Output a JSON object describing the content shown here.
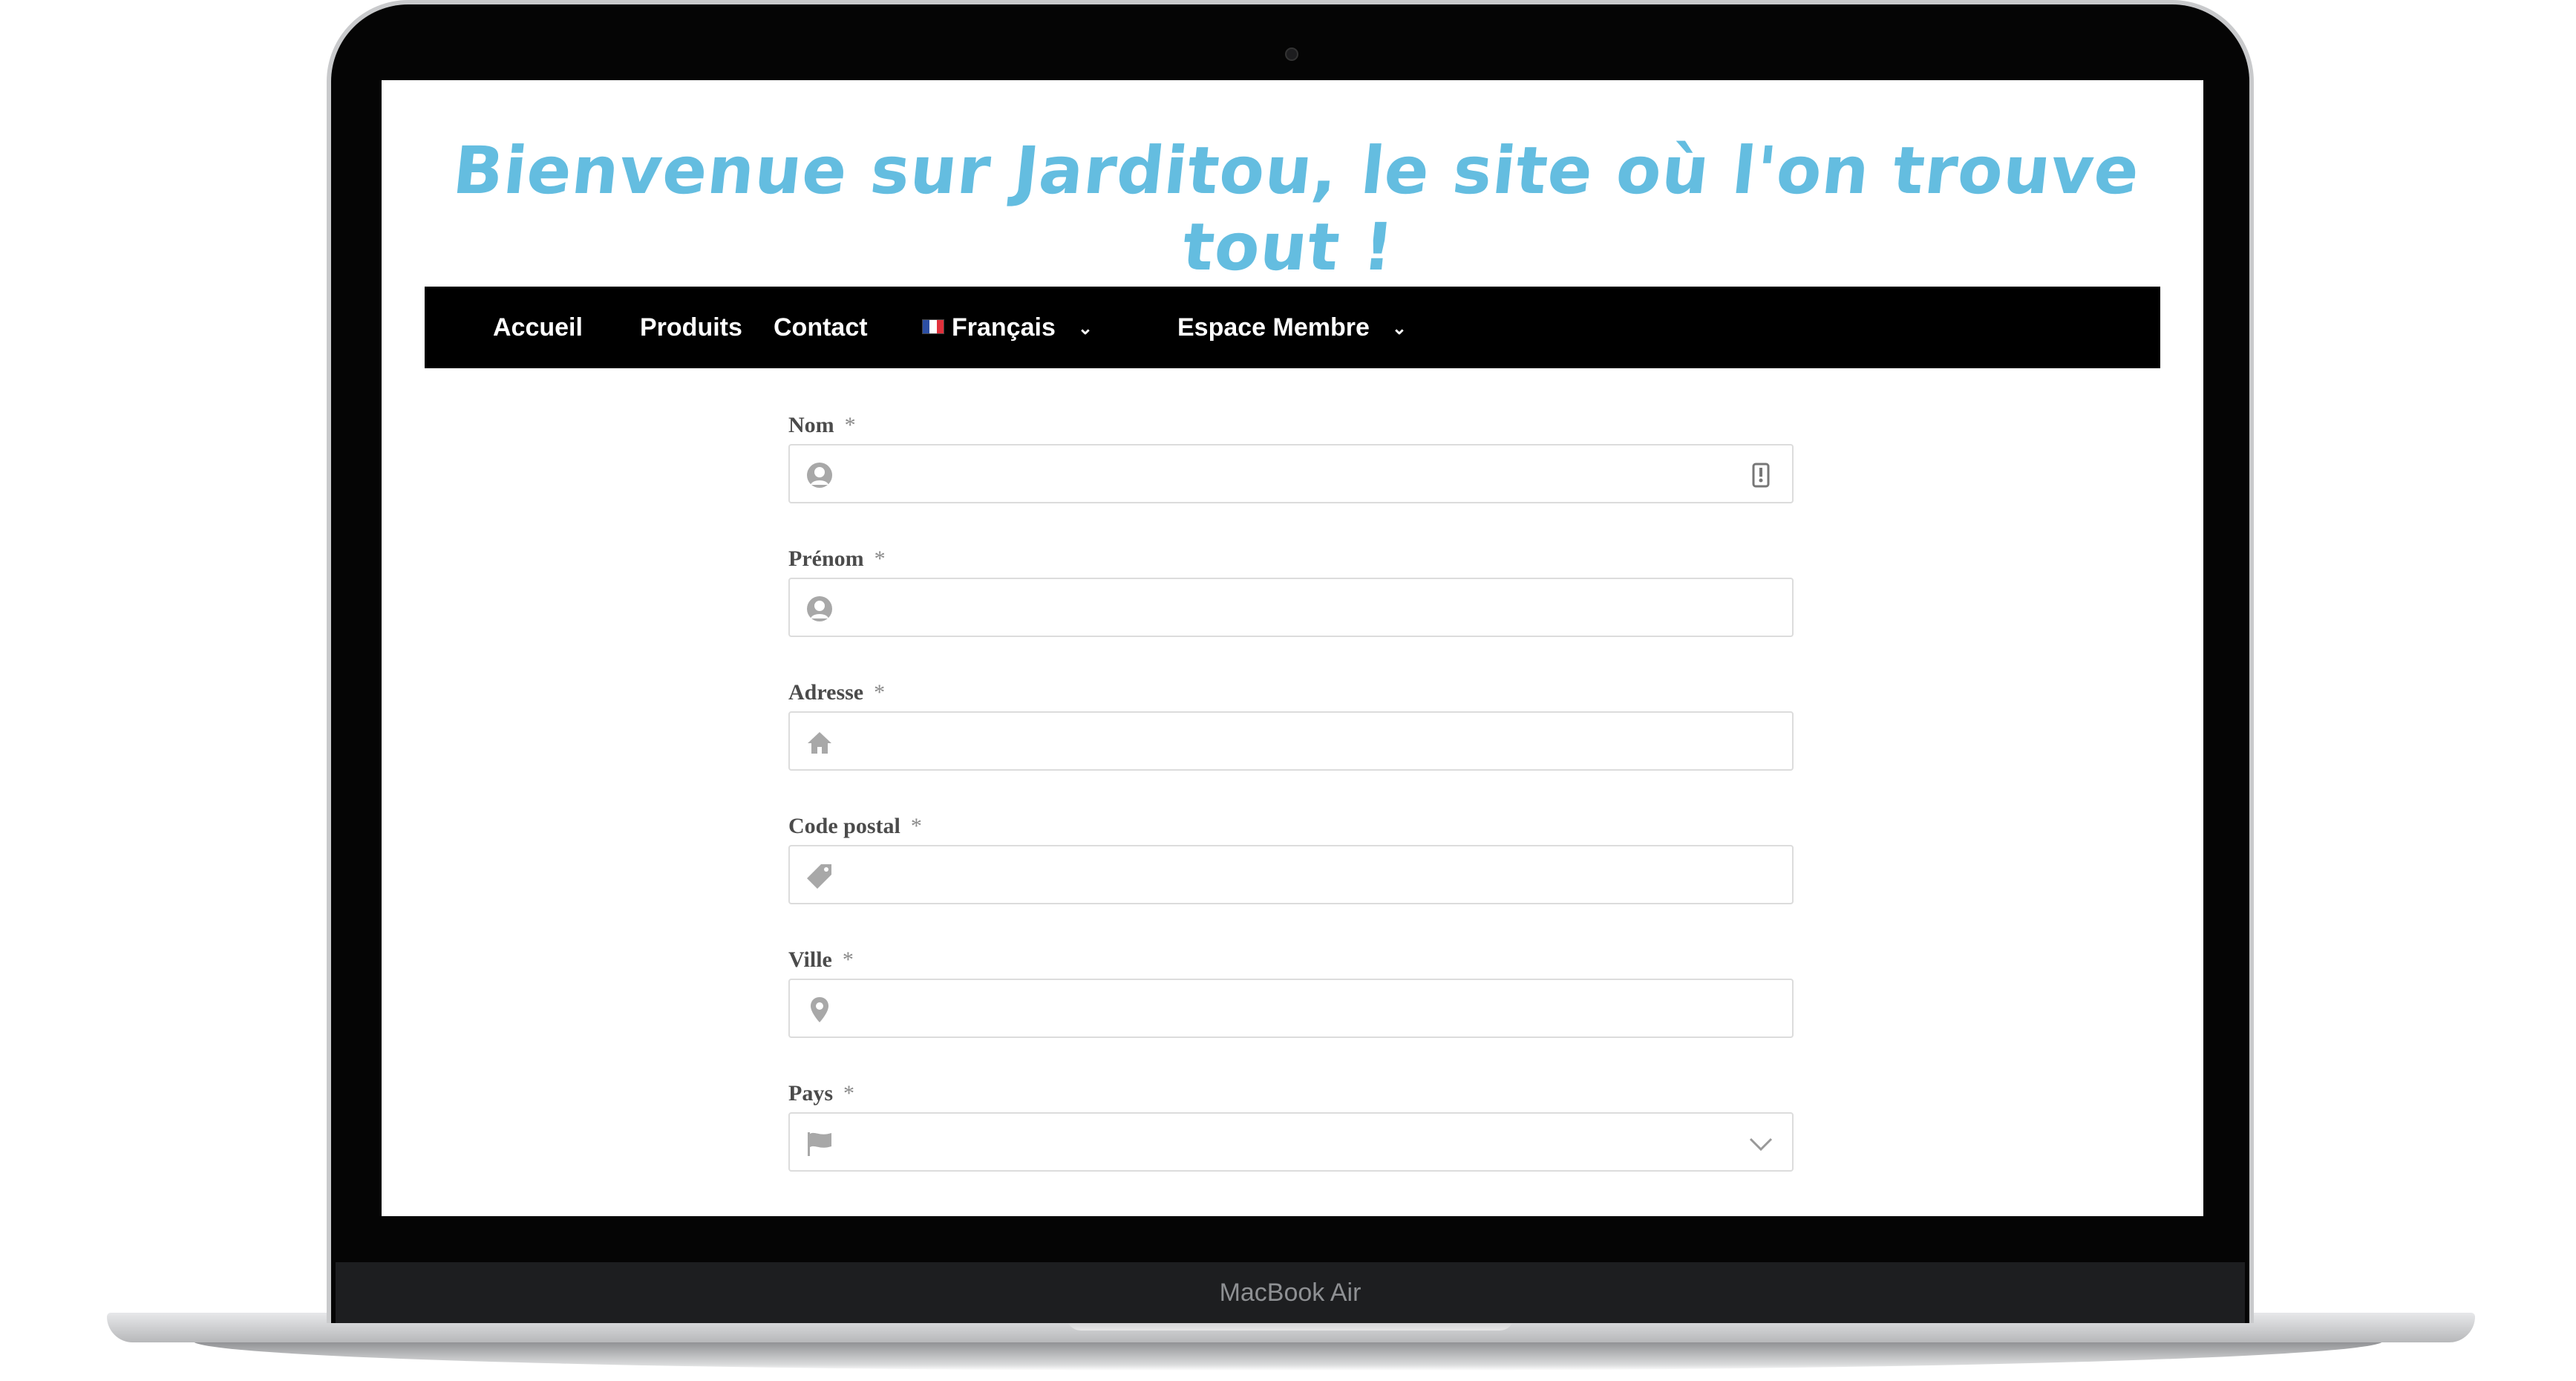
{
  "device": {
    "model_label": "MacBook Air"
  },
  "site": {
    "title": "Bienvenue sur Jarditou, le site où l'on trouve tout !"
  },
  "nav": {
    "items": [
      {
        "label": "Accueil"
      },
      {
        "label": "Produits"
      },
      {
        "label": "Contact"
      },
      {
        "label": "Français",
        "has_dropdown": true,
        "icon": "france-flag-icon"
      },
      {
        "label": "Espace Membre",
        "has_dropdown": true
      }
    ],
    "chevron": "⌄"
  },
  "form": {
    "required_mark": "*",
    "fields": [
      {
        "label": "Nom",
        "icon": "user-icon",
        "value": "",
        "right_icon": "autofill-icon"
      },
      {
        "label": "Prénom",
        "icon": "user-icon",
        "value": ""
      },
      {
        "label": "Adresse",
        "icon": "home-icon",
        "value": ""
      },
      {
        "label": "Code postal",
        "icon": "tag-icon",
        "value": ""
      },
      {
        "label": "Ville",
        "icon": "map-pin-icon",
        "value": ""
      },
      {
        "label": "Pays",
        "icon": "flag-icon",
        "value": "",
        "type": "select",
        "right_icon": "chevron-down-icon"
      }
    ]
  },
  "colors": {
    "title": "#64bde0",
    "navbar": "#000000",
    "icon_gray": "#a8a8a8"
  }
}
